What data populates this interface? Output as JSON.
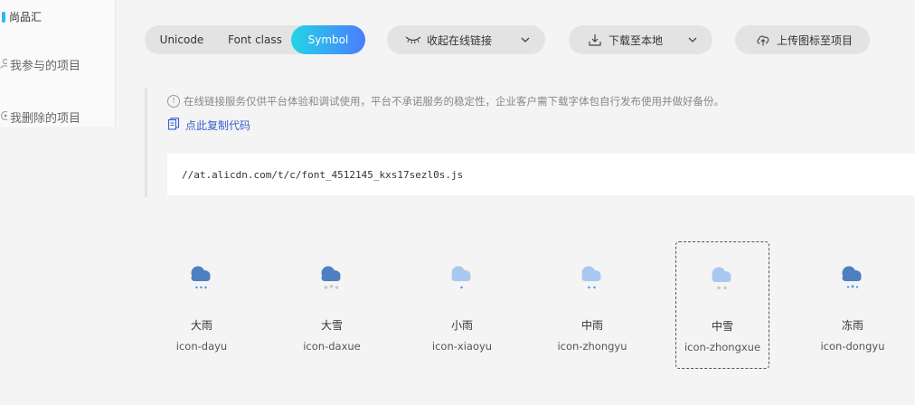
{
  "sidebar": {
    "active_label": "尚品汇",
    "items": [
      {
        "label": "我参与的项目",
        "icon": "user-icon"
      },
      {
        "label": "我删除的项目",
        "icon": "trash-icon"
      }
    ]
  },
  "toolbar": {
    "segments": [
      "Unicode",
      "Font class",
      "Symbol"
    ],
    "active_segment": "Symbol",
    "online_label": "收起在线链接",
    "download_label": "下载至本地",
    "upload_label": "上传图标至项目"
  },
  "notice": {
    "text": "在线链接服务仅供平台体验和调试使用，平台不承诺服务的稳定性，企业客户需下载字体包自行发布使用并做好备份。",
    "copy_label": "点此复制代码",
    "code": "//at.alicdn.com/t/c/font_4512145_kxs17sezl0s.js"
  },
  "icons": [
    {
      "name": "大雨",
      "code": "icon-dayu",
      "variant": "rain-heavy"
    },
    {
      "name": "大雪",
      "code": "icon-daxue",
      "variant": "snow-heavy"
    },
    {
      "name": "小雨",
      "code": "icon-xiaoyu",
      "variant": "rain-light"
    },
    {
      "name": "中雨",
      "code": "icon-zhongyu",
      "variant": "rain-medium"
    },
    {
      "name": "中雪",
      "code": "icon-zhongxue",
      "variant": "snow-medium"
    },
    {
      "name": "冻雨",
      "code": "icon-dongyu",
      "variant": "freezing-rain"
    }
  ],
  "selected_icon": "icon-zhongxue",
  "colors": {
    "accent_gradient_start": "#23d5e6",
    "accent_gradient_end": "#4a7cff",
    "cloud_dark": "#4d7fc1",
    "cloud_light": "#a9c8ef",
    "rain_drop": "#3f8fe8",
    "snow_flake": "#c9c9c9",
    "link": "#3b5fd0"
  }
}
